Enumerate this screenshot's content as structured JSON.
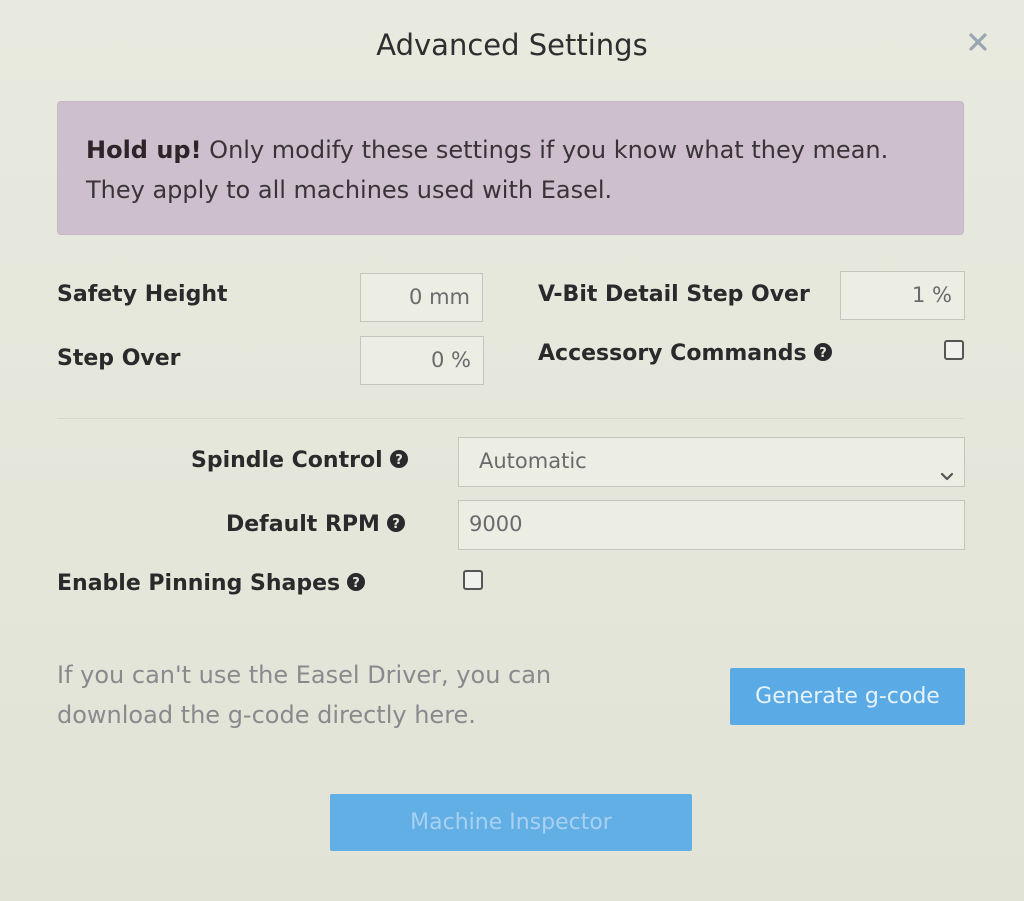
{
  "dialog": {
    "title": "Advanced Settings"
  },
  "warning": {
    "strong": "Hold up!",
    "text": " Only modify these settings if you know what they mean. They apply to all machines used with Easel."
  },
  "settings": {
    "safety_height": {
      "label": "Safety Height",
      "value": "0 mm"
    },
    "step_over": {
      "label": "Step Over",
      "value": "0 %"
    },
    "vbit_step_over": {
      "label": "V-Bit Detail Step Over",
      "value": "1 %"
    },
    "accessory_commands": {
      "label": "Accessory Commands",
      "checked": false
    },
    "spindle_control": {
      "label": "Spindle Control",
      "value": "Automatic"
    },
    "default_rpm": {
      "label": "Default RPM",
      "value": "9000"
    },
    "enable_pinning": {
      "label": "Enable Pinning Shapes",
      "checked": false
    }
  },
  "gcode": {
    "note": "If you can't use the Easel Driver, you can download the g-code directly here.",
    "button_label": "Generate g-code"
  },
  "inspector": {
    "button_label": "Machine Inspector"
  },
  "icons": {
    "close": "close-icon",
    "help": "question-circle-icon",
    "dropdown": "chevron-down-icon"
  },
  "colors": {
    "warning_bg": "#cdbfcd",
    "button_blue": "#5aaae6",
    "background": "#e6e7dc"
  }
}
